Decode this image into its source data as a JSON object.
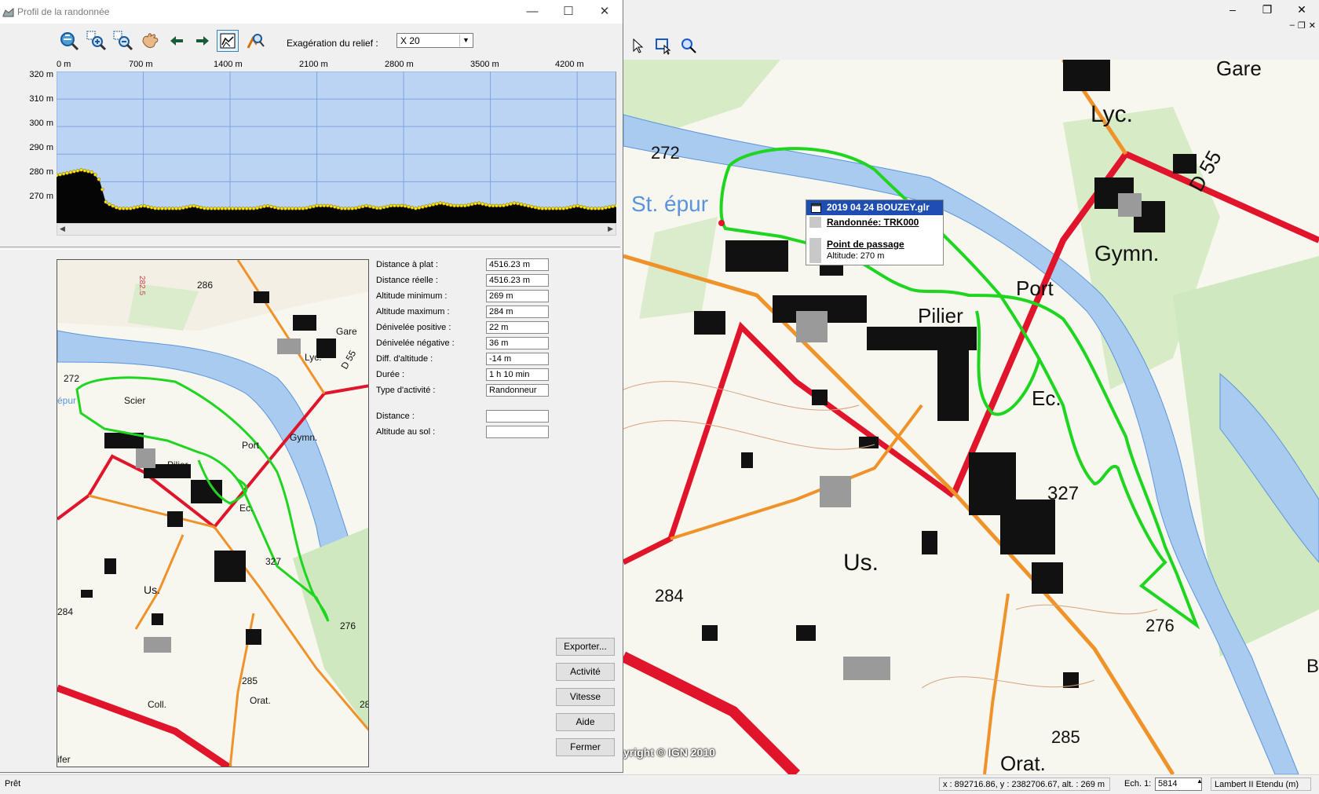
{
  "main_window": {
    "controls": {
      "minimize": "–",
      "maximize": "❐",
      "close": "✕"
    },
    "mdi_controls": {
      "minimize": "–",
      "restore": "❐",
      "close": "✕"
    },
    "map_labels": [
      "272",
      "St. épur",
      "Lyc.",
      "Gymn.",
      "Pilier",
      "Port",
      "Ec.",
      "327",
      "Us.",
      "284",
      "276",
      "285",
      "Orat.",
      "Gare",
      "D 55",
      "B"
    ],
    "copyright": "yright © IGN 2010",
    "popup": {
      "title": "2019 04 24 BOUZEY.glr",
      "track": "Randonnée: TRK000",
      "waypoint": "Point de passage",
      "altitude": "Altitude: 270 m"
    }
  },
  "statusbar": {
    "status": "Prêt",
    "coords": "x : 892716.86, y : 2382706.67, alt. : 269 m",
    "scale_label": "Ech. 1:",
    "scale_value": "5814",
    "projection": "Lambert II Etendu (m)"
  },
  "dialog": {
    "title": "Profil de la randonnée",
    "controls": {
      "minimize": "—",
      "maximize": "☐",
      "close": "✕"
    },
    "toolbar": {
      "tools": [
        "zoom-fit-icon",
        "zoom-in-icon",
        "zoom-out-icon",
        "pan-hand-icon",
        "arrow-left-icon",
        "arrow-right-icon",
        "profile-mode-icon",
        "pick-point-icon"
      ],
      "exaggeration_label": "Exagération du relief :",
      "exaggeration_value": "X 20"
    },
    "chart_labels": {
      "x_ticks": [
        "0 m",
        "700 m",
        "1400 m",
        "2100 m",
        "2800 m",
        "3500 m",
        "4200 m"
      ],
      "y_ticks": [
        "320 m",
        "310 m",
        "300 m",
        "290 m",
        "280 m",
        "270 m"
      ]
    },
    "minimap_labels": [
      "286",
      "282.5",
      "272",
      "épur",
      "Scier",
      "Lyc.",
      "Gare",
      "D 55",
      "Gymn.",
      "Pilier",
      "Port",
      "Ec.",
      "327",
      "Us.",
      "284",
      "276",
      "285",
      "Coll.",
      "Orat.",
      "28",
      "ifer"
    ],
    "stats": [
      {
        "label": "Distance à plat :",
        "value": "4516.23 m"
      },
      {
        "label": "Distance réelle :",
        "value": "4516.23 m"
      },
      {
        "label": "Altitude minimum :",
        "value": "269 m"
      },
      {
        "label": "Altitude maximum :",
        "value": "284 m"
      },
      {
        "label": "Dénivelée positive :",
        "value": "22 m"
      },
      {
        "label": "Dénivelée négative :",
        "value": "36 m"
      },
      {
        "label": "Diff. d'altitude :",
        "value": "-14 m"
      },
      {
        "label": "Durée :",
        "value": "1 h 10 min"
      },
      {
        "label": "Type d'activité :",
        "value": "Randonneur"
      }
    ],
    "cursor_stats": [
      {
        "label": "Distance :",
        "value": ""
      },
      {
        "label": "Altitude au sol :",
        "value": ""
      }
    ],
    "buttons": {
      "export": "Exporter...",
      "activity": "Activité",
      "speed": "Vitesse",
      "help": "Aide",
      "close": "Fermer"
    }
  },
  "chart_data": {
    "type": "area",
    "title": "",
    "xlabel": "",
    "ylabel": "",
    "xlim": [
      0,
      4516
    ],
    "ylim": [
      265,
      320
    ],
    "grid": true,
    "x": [
      0,
      100,
      200,
      300,
      350,
      400,
      500,
      600,
      700,
      800,
      900,
      1000,
      1100,
      1200,
      1300,
      1400,
      1500,
      1600,
      1700,
      1800,
      1900,
      2000,
      2100,
      2200,
      2300,
      2400,
      2500,
      2600,
      2700,
      2800,
      2900,
      3000,
      3100,
      3200,
      3300,
      3400,
      3500,
      3600,
      3700,
      3800,
      3900,
      4000,
      4100,
      4200,
      4300,
      4400,
      4516
    ],
    "series": [
      {
        "values": [
          282,
          283,
          284,
          283,
          280,
          272,
          270,
          270,
          271,
          270,
          270,
          270,
          271,
          270,
          270,
          270,
          270,
          270,
          271,
          270,
          270,
          270,
          271,
          271,
          270,
          270,
          271,
          270,
          271,
          271,
          270,
          271,
          272,
          271,
          271,
          272,
          271,
          271,
          272,
          271,
          270,
          270,
          270,
          271,
          270,
          270,
          271
        ]
      }
    ]
  }
}
